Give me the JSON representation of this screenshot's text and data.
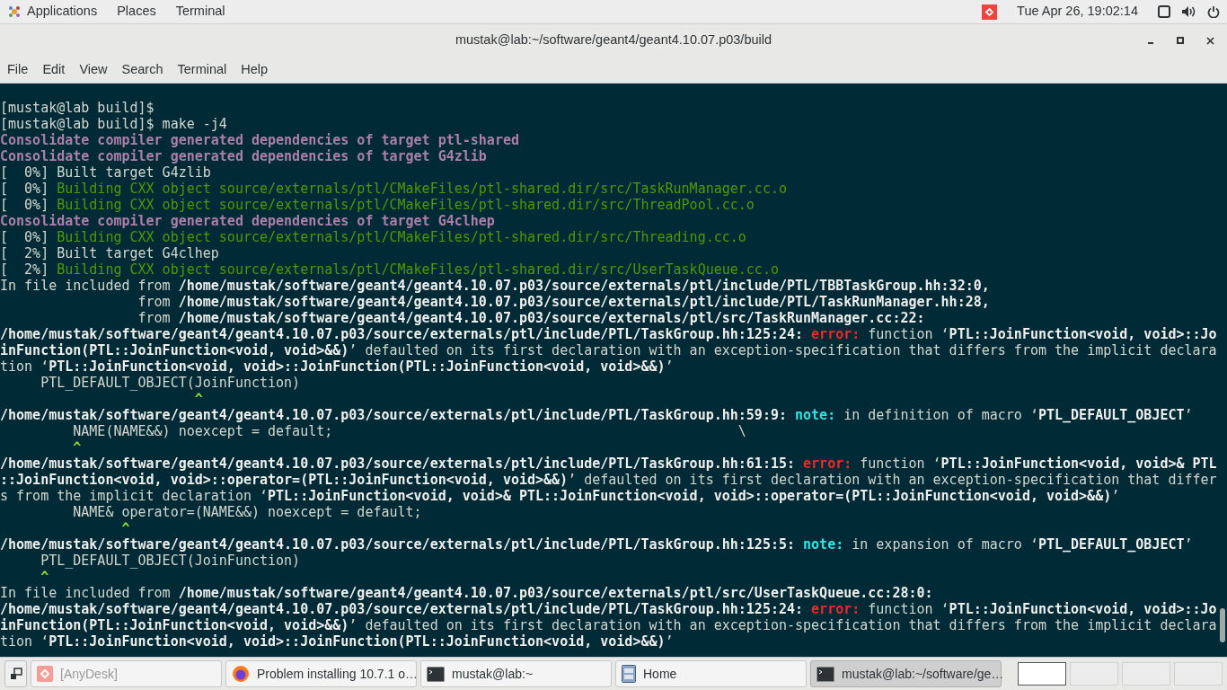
{
  "top_bar": {
    "menus": [
      "Applications",
      "Places",
      "Terminal"
    ],
    "clock": "Tue Apr 26, 19:02:14"
  },
  "window": {
    "title": "mustak@lab:~/software/geant4/geant4.10.07.p03/build",
    "menu": [
      "File",
      "Edit",
      "View",
      "Search",
      "Terminal",
      "Help"
    ]
  },
  "terminal": {
    "lines": [
      [
        {
          "kind": "plain",
          "text": "[mustak@lab build]$"
        }
      ],
      [
        {
          "kind": "plain",
          "text": "[mustak@lab build]$ make -j4"
        }
      ],
      [
        {
          "kind": "target",
          "text": "Consolidate compiler generated dependencies of target ptl-shared"
        }
      ],
      [
        {
          "kind": "target",
          "text": "Consolidate compiler generated dependencies of target G4zlib"
        }
      ],
      [
        {
          "kind": "plain",
          "text": "[  0%] Built target G4zlib"
        }
      ],
      [
        {
          "kind": "plain",
          "text": "[  0%] "
        },
        {
          "kind": "build",
          "text": "Building CXX object source/externals/ptl/CMakeFiles/ptl-shared.dir/src/TaskRunManager.cc.o"
        }
      ],
      [
        {
          "kind": "plain",
          "text": "[  0%] "
        },
        {
          "kind": "build",
          "text": "Building CXX object source/externals/ptl/CMakeFiles/ptl-shared.dir/src/ThreadPool.cc.o"
        }
      ],
      [
        {
          "kind": "target",
          "text": "Consolidate compiler generated dependencies of target G4clhep"
        }
      ],
      [
        {
          "kind": "plain",
          "text": "[  0%] "
        },
        {
          "kind": "build",
          "text": "Building CXX object source/externals/ptl/CMakeFiles/ptl-shared.dir/src/Threading.cc.o"
        }
      ],
      [
        {
          "kind": "plain",
          "text": "[  2%] Built target G4clhep"
        }
      ],
      [
        {
          "kind": "plain",
          "text": "[  2%] "
        },
        {
          "kind": "build",
          "text": "Building CXX object source/externals/ptl/CMakeFiles/ptl-shared.dir/src/UserTaskQueue.cc.o"
        }
      ],
      [
        {
          "kind": "plain",
          "text": "In file included from "
        },
        {
          "kind": "bold",
          "text": "/home/mustak/software/geant4/geant4.10.07.p03/source/externals/ptl/include/PTL/TBBTaskGroup.hh:32:0,"
        }
      ],
      [
        {
          "kind": "plain",
          "text": "                 from "
        },
        {
          "kind": "bold",
          "text": "/home/mustak/software/geant4/geant4.10.07.p03/source/externals/ptl/include/PTL/TaskRunManager.hh:28,"
        }
      ],
      [
        {
          "kind": "plain",
          "text": "                 from "
        },
        {
          "kind": "bold",
          "text": "/home/mustak/software/geant4/geant4.10.07.p03/source/externals/ptl/src/TaskRunManager.cc:22:"
        }
      ],
      [
        {
          "kind": "bold",
          "text": "/home/mustak/software/geant4/geant4.10.07.p03/source/externals/ptl/include/PTL/TaskGroup.hh:125:24: "
        },
        {
          "kind": "error",
          "text": "error:"
        },
        {
          "kind": "plain",
          "text": " function ‘"
        },
        {
          "kind": "bold",
          "text": "PTL::JoinFunction<void, void>::Jo"
        }
      ],
      [
        {
          "kind": "bold",
          "text": "inFunction(PTL::JoinFunction<void, void>&&)"
        },
        {
          "kind": "plain",
          "text": "’ defaulted on its first declaration with an exception-specification that differs from the implicit declara"
        }
      ],
      [
        {
          "kind": "plain",
          "text": "tion ‘"
        },
        {
          "kind": "bold",
          "text": "PTL::JoinFunction<void, void>::JoinFunction(PTL::JoinFunction<void, void>&&)"
        },
        {
          "kind": "plain",
          "text": "’"
        }
      ],
      [
        {
          "kind": "plain",
          "text": "     PTL_DEFAULT_OBJECT(JoinFunction)"
        }
      ],
      [
        {
          "kind": "caret",
          "text": "                        ^"
        }
      ],
      [
        {
          "kind": "bold",
          "text": "/home/mustak/software/geant4/geant4.10.07.p03/source/externals/ptl/include/PTL/TaskGroup.hh:59:9: "
        },
        {
          "kind": "note",
          "text": "note:"
        },
        {
          "kind": "plain",
          "text": " in definition of macro ‘"
        },
        {
          "kind": "bold",
          "text": "PTL_DEFAULT_OBJECT"
        },
        {
          "kind": "plain",
          "text": "’"
        }
      ],
      [
        {
          "kind": "plain",
          "text": "         NAME(NAME&&) noexcept = default;                                                  \\"
        }
      ],
      [
        {
          "kind": "caret",
          "text": "         ^"
        }
      ],
      [
        {
          "kind": "bold",
          "text": "/home/mustak/software/geant4/geant4.10.07.p03/source/externals/ptl/include/PTL/TaskGroup.hh:61:15: "
        },
        {
          "kind": "error",
          "text": "error:"
        },
        {
          "kind": "plain",
          "text": " function ‘"
        },
        {
          "kind": "bold",
          "text": "PTL::JoinFunction<void, void>& PTL"
        }
      ],
      [
        {
          "kind": "bold",
          "text": "::JoinFunction<void, void>::operator=(PTL::JoinFunction<void, void>&&)"
        },
        {
          "kind": "plain",
          "text": "’ defaulted on its first declaration with an exception-specification that differ"
        }
      ],
      [
        {
          "kind": "plain",
          "text": "s from the implicit declaration ‘"
        },
        {
          "kind": "bold",
          "text": "PTL::JoinFunction<void, void>& PTL::JoinFunction<void, void>::operator=(PTL::JoinFunction<void, void>&&)"
        },
        {
          "kind": "plain",
          "text": "’"
        }
      ],
      [
        {
          "kind": "plain",
          "text": "         NAME& operator=(NAME&&) noexcept = default;"
        }
      ],
      [
        {
          "kind": "caret",
          "text": "               ^"
        }
      ],
      [
        {
          "kind": "bold",
          "text": "/home/mustak/software/geant4/geant4.10.07.p03/source/externals/ptl/include/PTL/TaskGroup.hh:125:5: "
        },
        {
          "kind": "note",
          "text": "note:"
        },
        {
          "kind": "plain",
          "text": " in expansion of macro ‘"
        },
        {
          "kind": "bold",
          "text": "PTL_DEFAULT_OBJECT"
        },
        {
          "kind": "plain",
          "text": "’"
        }
      ],
      [
        {
          "kind": "plain",
          "text": "     PTL_DEFAULT_OBJECT(JoinFunction)"
        }
      ],
      [
        {
          "kind": "caret",
          "text": "     ^"
        }
      ],
      [
        {
          "kind": "plain",
          "text": "In file included from "
        },
        {
          "kind": "bold",
          "text": "/home/mustak/software/geant4/geant4.10.07.p03/source/externals/ptl/src/UserTaskQueue.cc:28:0:"
        }
      ],
      [
        {
          "kind": "bold",
          "text": "/home/mustak/software/geant4/geant4.10.07.p03/source/externals/ptl/include/PTL/TaskGroup.hh:125:24: "
        },
        {
          "kind": "error",
          "text": "error:"
        },
        {
          "kind": "plain",
          "text": " function ‘"
        },
        {
          "kind": "bold",
          "text": "PTL::JoinFunction<void, void>::Jo"
        }
      ],
      [
        {
          "kind": "bold",
          "text": "inFunction(PTL::JoinFunction<void, void>&&)"
        },
        {
          "kind": "plain",
          "text": "’ defaulted on its first declaration with an exception-specification that differs from the implicit declara"
        }
      ],
      [
        {
          "kind": "plain",
          "text": "tion ‘"
        },
        {
          "kind": "bold",
          "text": "PTL::JoinFunction<void, void>::JoinFunction(PTL::JoinFunction<void, void>&&)"
        },
        {
          "kind": "plain",
          "text": "’"
        }
      ]
    ]
  },
  "taskbar": {
    "items": [
      {
        "kind": "anydesk",
        "label": "[AnyDesk]",
        "disabled": true,
        "selected": false
      },
      {
        "kind": "browser",
        "label": "Problem installing 10.7.1 o…",
        "disabled": false,
        "selected": false
      },
      {
        "kind": "terminal",
        "label": "mustak@lab:~",
        "disabled": false,
        "selected": false
      },
      {
        "kind": "files",
        "label": "Home",
        "disabled": false,
        "selected": false
      },
      {
        "kind": "terminal",
        "label": "mustak@lab:~/software/ge…",
        "disabled": false,
        "selected": true
      }
    ],
    "workspaces": [
      {
        "selected": true
      },
      {
        "selected": false
      },
      {
        "selected": false
      },
      {
        "selected": false
      }
    ]
  }
}
